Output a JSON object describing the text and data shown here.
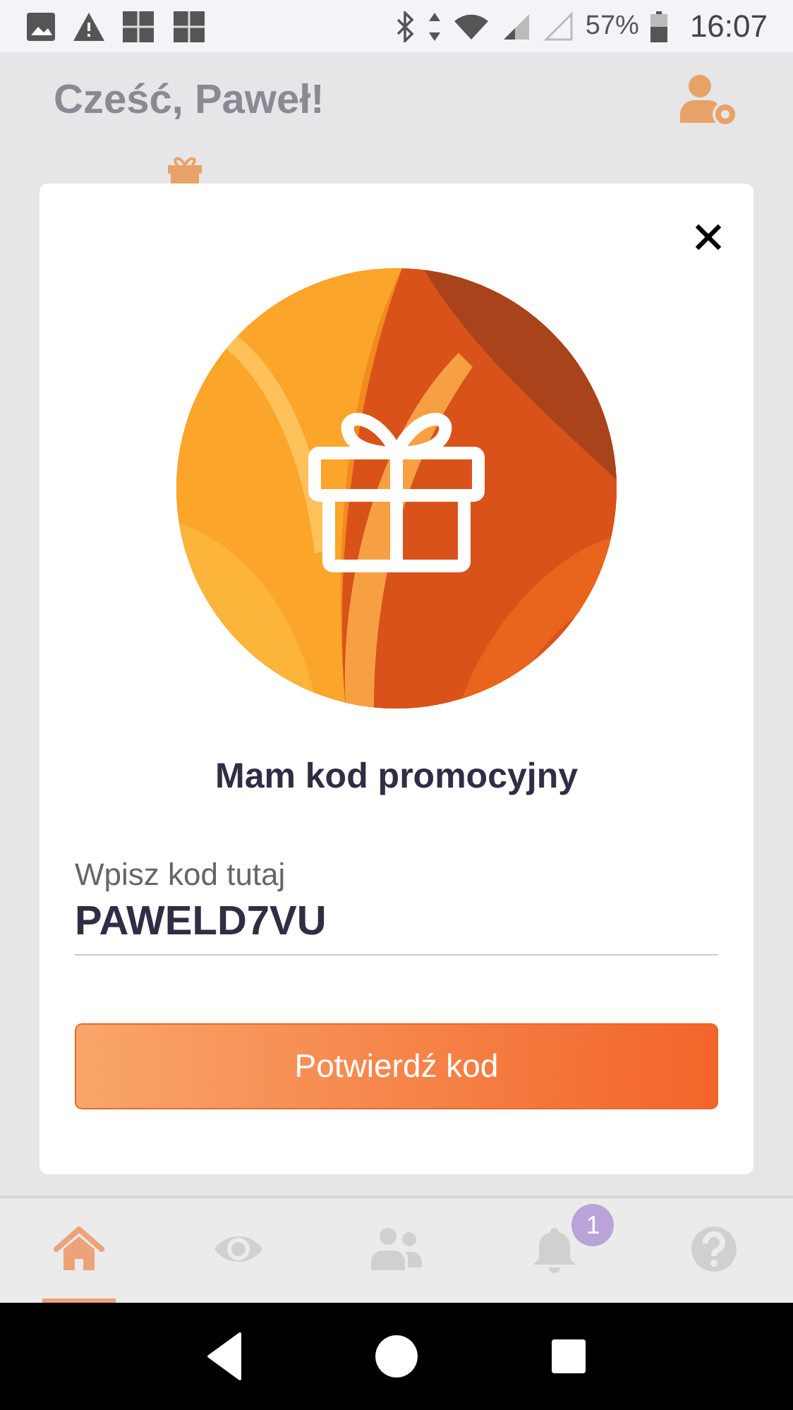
{
  "status_bar": {
    "battery": "57%",
    "time": "16:07"
  },
  "header": {
    "greeting": "Cześć, Paweł!"
  },
  "dialog": {
    "title": "Mam kod promocyjny",
    "field": {
      "label": "Wpisz kod tutaj",
      "value": "PAWELD7VU"
    },
    "button": "Potwierdź kod"
  },
  "tabs": [
    {
      "kind": "home",
      "selected": true
    },
    {
      "kind": "eye",
      "selected": false
    },
    {
      "kind": "people",
      "selected": false
    },
    {
      "kind": "bell",
      "selected": false,
      "badge": "1"
    },
    {
      "kind": "help",
      "selected": false
    }
  ]
}
